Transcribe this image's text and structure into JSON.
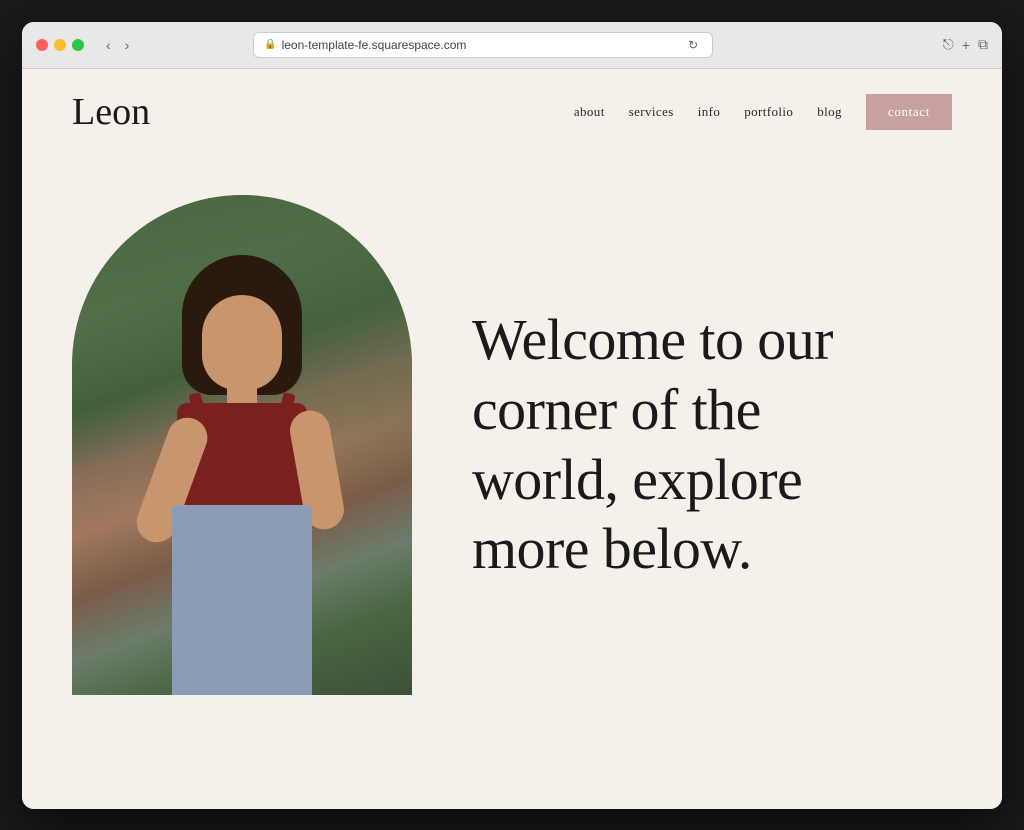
{
  "browser": {
    "url": "leon-template-fe.squarespace.com",
    "back_label": "‹",
    "forward_label": "›",
    "refresh_label": "↻",
    "share_label": "⎋",
    "new_tab_label": "+",
    "duplicate_label": "⧉"
  },
  "site": {
    "logo": "Leon",
    "nav": {
      "links": [
        {
          "label": "about",
          "href": "#"
        },
        {
          "label": "services",
          "href": "#"
        },
        {
          "label": "info",
          "href": "#"
        },
        {
          "label": "portfolio",
          "href": "#"
        },
        {
          "label": "blog",
          "href": "#"
        }
      ],
      "contact_label": "contact"
    },
    "hero": {
      "heading_line1": "Welcome to our",
      "heading_line2": "corner of the",
      "heading_line3": "world, explore",
      "heading_line4": "more below.",
      "full_heading": "Welcome to our corner of the world, explore more below."
    }
  },
  "colors": {
    "bg": "#f5f0ea",
    "accent_pink": "#c9a0a0",
    "deco_circle": "#d4a59a",
    "text_dark": "#1a1a1a",
    "nav_link": "#2a2a2a"
  }
}
